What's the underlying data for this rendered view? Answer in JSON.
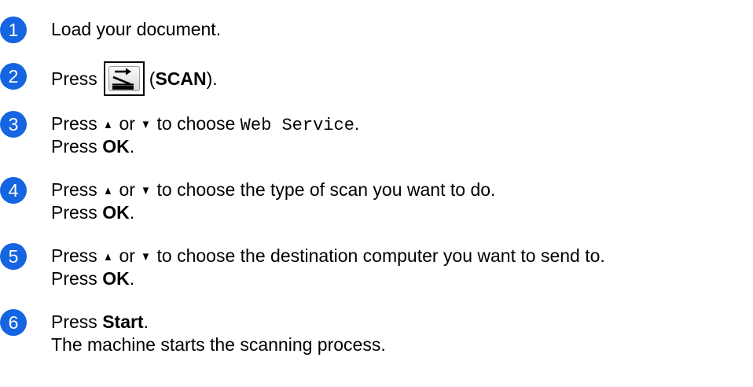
{
  "colors": {
    "step_badge": "#1565e0",
    "text": "#000000"
  },
  "steps": [
    {
      "number": "1",
      "line1": {
        "text": "Load your document."
      }
    },
    {
      "number": "2",
      "line1": {
        "prefix": "Press",
        "key_icon": "scan-key-icon",
        "open_paren": "(",
        "key_label": "SCAN",
        "close": ")."
      }
    },
    {
      "number": "3",
      "line1": {
        "prefix": "Press",
        "up": "▲",
        "or": "or",
        "down": "▼",
        "middle": "to choose",
        "mono_value": "Web Service",
        "end": "."
      },
      "line2": {
        "prefix": "Press",
        "key": "OK",
        "end": "."
      }
    },
    {
      "number": "4",
      "line1": {
        "prefix": "Press",
        "up": "▲",
        "or": "or",
        "down": "▼",
        "rest": "to choose the type of scan you want to do."
      },
      "line2": {
        "prefix": "Press",
        "key": "OK",
        "end": "."
      }
    },
    {
      "number": "5",
      "line1": {
        "prefix": "Press",
        "up": "▲",
        "or": "or",
        "down": "▼",
        "rest": "to choose the destination computer you want to send to."
      },
      "line2": {
        "prefix": "Press",
        "key": "OK",
        "end": "."
      }
    },
    {
      "number": "6",
      "line1": {
        "prefix": "Press",
        "key": "Start",
        "end": "."
      },
      "line2": {
        "text": "The machine starts the scanning process."
      }
    }
  ]
}
